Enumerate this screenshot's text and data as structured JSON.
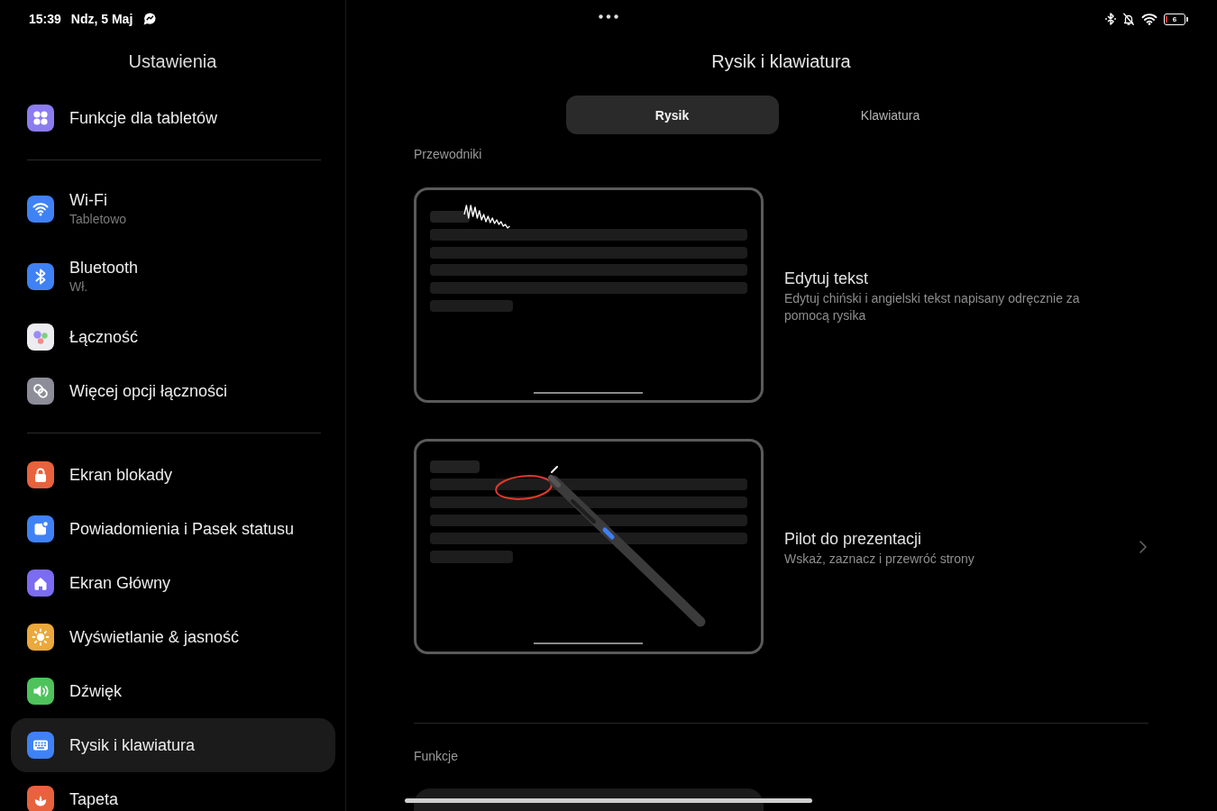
{
  "status_bar": {
    "time": "15:39",
    "date": "Ndz, 5 Maj",
    "battery": "6"
  },
  "sidebar": {
    "title": "Ustawienia",
    "groups": [
      {
        "items": [
          {
            "label": "Funkcje dla tabletów",
            "selected": false
          }
        ]
      },
      {
        "items": [
          {
            "label": "Wi-Fi",
            "subtitle": "Tabletowo",
            "selected": false
          },
          {
            "label": "Bluetooth",
            "subtitle": "Wł.",
            "selected": false
          },
          {
            "label": "Łączność",
            "selected": false
          },
          {
            "label": "Więcej opcji łączności",
            "selected": false
          }
        ]
      },
      {
        "items": [
          {
            "label": "Ekran blokady",
            "selected": false
          },
          {
            "label": "Powiadomienia i Pasek statusu",
            "selected": false
          },
          {
            "label": "Ekran Główny",
            "selected": false
          },
          {
            "label": "Wyświetlanie & jasność",
            "selected": false
          },
          {
            "label": "Dźwięk",
            "selected": false
          },
          {
            "label": "Rysik i klawiatura",
            "selected": true
          },
          {
            "label": "Tapeta",
            "selected": false
          }
        ]
      }
    ]
  },
  "main": {
    "title": "Rysik i klawiatura",
    "tabs": [
      {
        "label": "Rysik",
        "selected": true
      },
      {
        "label": "Klawiatura",
        "selected": false
      }
    ],
    "guides": {
      "heading": "Przewodniki",
      "items": [
        {
          "title": "Edytuj tekst",
          "description": "Edytuj chiński i angielski tekst napisany odręcznie za pomocą rysika",
          "chevron": false
        },
        {
          "title": "Pilot do prezentacji",
          "description": "Wskaż, zaznacz i przewróć strony",
          "chevron": true
        }
      ]
    },
    "features": {
      "heading": "Funkcje"
    }
  }
}
